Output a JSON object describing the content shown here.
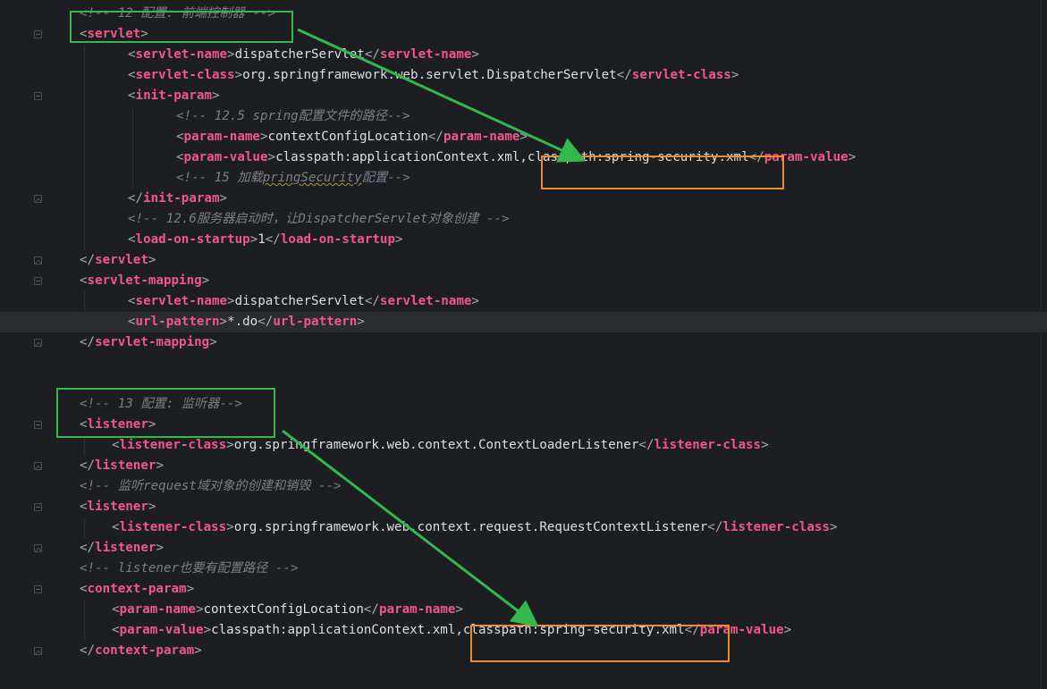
{
  "editor": {
    "lines": [
      {
        "parts": [
          {
            "t": "<!-- 12 配置: 前端控制器 -->",
            "c": "cm"
          }
        ]
      },
      {
        "parts": [
          {
            "t": "<",
            "c": "tb"
          },
          {
            "t": "servlet",
            "c": "tn"
          },
          {
            "t": ">",
            "c": "tb"
          }
        ]
      },
      {
        "parts": [
          {
            "t": "<",
            "c": "tb"
          },
          {
            "t": "servlet-name",
            "c": "tn"
          },
          {
            "t": ">",
            "c": "tb"
          },
          {
            "t": "dispatcherServlet",
            "c": "tx"
          },
          {
            "t": "</",
            "c": "tb"
          },
          {
            "t": "servlet-name",
            "c": "tn"
          },
          {
            "t": ">",
            "c": "tb"
          }
        ]
      },
      {
        "parts": [
          {
            "t": "<",
            "c": "tb"
          },
          {
            "t": "servlet-class",
            "c": "tn"
          },
          {
            "t": ">",
            "c": "tb"
          },
          {
            "t": "org.springframework.web.servlet.DispatcherServlet",
            "c": "tx"
          },
          {
            "t": "</",
            "c": "tb"
          },
          {
            "t": "servlet-class",
            "c": "tn"
          },
          {
            "t": ">",
            "c": "tb"
          }
        ]
      },
      {
        "parts": [
          {
            "t": "<",
            "c": "tb"
          },
          {
            "t": "init-param",
            "c": "tn"
          },
          {
            "t": ">",
            "c": "tb"
          }
        ]
      },
      {
        "parts": [
          {
            "t": "<!-- 12.5 spring配置文件的路径-->",
            "c": "cm"
          }
        ]
      },
      {
        "parts": [
          {
            "t": "<",
            "c": "tb"
          },
          {
            "t": "param-name",
            "c": "tn"
          },
          {
            "t": ">",
            "c": "tb"
          },
          {
            "t": "contextConfigLocation",
            "c": "tx"
          },
          {
            "t": "</",
            "c": "tb"
          },
          {
            "t": "param-name",
            "c": "tn"
          },
          {
            "t": ">",
            "c": "tb"
          }
        ]
      },
      {
        "parts": [
          {
            "t": "<",
            "c": "tb"
          },
          {
            "t": "param-value",
            "c": "tn"
          },
          {
            "t": ">",
            "c": "tb"
          },
          {
            "t": "classpath:applicationContext.xml,classpath:spring-security.xml",
            "c": "tx"
          },
          {
            "t": "</",
            "c": "tb"
          },
          {
            "t": "param-value",
            "c": "tn"
          },
          {
            "t": ">",
            "c": "tb"
          }
        ]
      },
      {
        "parts": [
          {
            "t": "<!-- 15 加载",
            "c": "cm"
          },
          {
            "t": "pringSecurity",
            "c": "cm sq"
          },
          {
            "t": "配置-->",
            "c": "cm"
          }
        ]
      },
      {
        "parts": [
          {
            "t": "</",
            "c": "tb"
          },
          {
            "t": "init-param",
            "c": "tn"
          },
          {
            "t": ">",
            "c": "tb"
          }
        ]
      },
      {
        "parts": [
          {
            "t": "<!-- 12.6服务器启动时，让DispatcherServlet对象创建 -->",
            "c": "cm"
          }
        ]
      },
      {
        "parts": [
          {
            "t": "<",
            "c": "tb"
          },
          {
            "t": "load-on-startup",
            "c": "tn"
          },
          {
            "t": ">",
            "c": "tb"
          },
          {
            "t": "1",
            "c": "tx"
          },
          {
            "t": "</",
            "c": "tb"
          },
          {
            "t": "load-on-startup",
            "c": "tn"
          },
          {
            "t": ">",
            "c": "tb"
          }
        ]
      },
      {
        "parts": [
          {
            "t": "</",
            "c": "tb"
          },
          {
            "t": "servlet",
            "c": "tn"
          },
          {
            "t": ">",
            "c": "tb"
          }
        ]
      },
      {
        "parts": [
          {
            "t": "<",
            "c": "tb"
          },
          {
            "t": "servlet-mapping",
            "c": "tn"
          },
          {
            "t": ">",
            "c": "tb"
          }
        ]
      },
      {
        "parts": [
          {
            "t": "<",
            "c": "tb"
          },
          {
            "t": "servlet-name",
            "c": "tn"
          },
          {
            "t": ">",
            "c": "tb"
          },
          {
            "t": "dispatcherServlet",
            "c": "tx"
          },
          {
            "t": "</",
            "c": "tb"
          },
          {
            "t": "servlet-name",
            "c": "tn"
          },
          {
            "t": ">",
            "c": "tb"
          }
        ]
      },
      {
        "parts": [
          {
            "t": "<",
            "c": "tb"
          },
          {
            "t": "url-pattern",
            "c": "tn"
          },
          {
            "t": ">",
            "c": "tb"
          },
          {
            "t": "*.do",
            "c": "tx"
          },
          {
            "t": "</",
            "c": "tb"
          },
          {
            "t": "url-pattern",
            "c": "tn"
          },
          {
            "t": ">",
            "c": "tb"
          }
        ]
      },
      {
        "parts": [
          {
            "t": "</",
            "c": "tb"
          },
          {
            "t": "servlet-mapping",
            "c": "tn"
          },
          {
            "t": ">",
            "c": "tb"
          }
        ]
      },
      {
        "parts": []
      },
      {
        "parts": []
      },
      {
        "parts": [
          {
            "t": "<!-- 13 配置: 监听器-->",
            "c": "cm"
          }
        ]
      },
      {
        "parts": [
          {
            "t": "<",
            "c": "tb"
          },
          {
            "t": "listener",
            "c": "tn"
          },
          {
            "t": ">",
            "c": "tb"
          }
        ]
      },
      {
        "parts": [
          {
            "t": "<",
            "c": "tb"
          },
          {
            "t": "listener-class",
            "c": "tn"
          },
          {
            "t": ">",
            "c": "tb"
          },
          {
            "t": "org.springframework.web.context.ContextLoaderListener",
            "c": "tx"
          },
          {
            "t": "</",
            "c": "tb"
          },
          {
            "t": "listener-class",
            "c": "tn"
          },
          {
            "t": ">",
            "c": "tb"
          }
        ]
      },
      {
        "parts": [
          {
            "t": "</",
            "c": "tb"
          },
          {
            "t": "listener",
            "c": "tn"
          },
          {
            "t": ">",
            "c": "tb"
          }
        ]
      },
      {
        "parts": [
          {
            "t": "<!-- 监听request域对象的创建和销毁 -->",
            "c": "cm"
          }
        ]
      },
      {
        "parts": [
          {
            "t": "<",
            "c": "tb"
          },
          {
            "t": "listener",
            "c": "tn"
          },
          {
            "t": ">",
            "c": "tb"
          }
        ]
      },
      {
        "parts": [
          {
            "t": "<",
            "c": "tb"
          },
          {
            "t": "listener-class",
            "c": "tn"
          },
          {
            "t": ">",
            "c": "tb"
          },
          {
            "t": "org.springframework.web.context.request.RequestContextListener",
            "c": "tx"
          },
          {
            "t": "</",
            "c": "tb"
          },
          {
            "t": "listener-class",
            "c": "tn"
          },
          {
            "t": ">",
            "c": "tb"
          }
        ]
      },
      {
        "parts": [
          {
            "t": "</",
            "c": "tb"
          },
          {
            "t": "listener",
            "c": "tn"
          },
          {
            "t": ">",
            "c": "tb"
          }
        ]
      },
      {
        "parts": [
          {
            "t": "<!-- listener也要有配置路径 -->",
            "c": "cm"
          }
        ]
      },
      {
        "parts": [
          {
            "t": "<",
            "c": "tb"
          },
          {
            "t": "context-param",
            "c": "tn"
          },
          {
            "t": ">",
            "c": "tb"
          }
        ]
      },
      {
        "parts": [
          {
            "t": "<",
            "c": "tb"
          },
          {
            "t": "param-name",
            "c": "tn"
          },
          {
            "t": ">",
            "c": "tb"
          },
          {
            "t": "contextConfigLocation",
            "c": "tx"
          },
          {
            "t": "</",
            "c": "tb"
          },
          {
            "t": "param-name",
            "c": "tn"
          },
          {
            "t": ">",
            "c": "tb"
          }
        ]
      },
      {
        "parts": [
          {
            "t": "<",
            "c": "tb"
          },
          {
            "t": "param-value",
            "c": "tn"
          },
          {
            "t": ">",
            "c": "tb"
          },
          {
            "t": "classpath:applicationContext.xml,classpath:spring-security.xml",
            "c": "tx"
          },
          {
            "t": "</",
            "c": "tb"
          },
          {
            "t": "param-value",
            "c": "tn"
          },
          {
            "t": ">",
            "c": "tb"
          }
        ]
      },
      {
        "parts": [
          {
            "t": "</",
            "c": "tb"
          },
          {
            "t": "context-param",
            "c": "tn"
          },
          {
            "t": ">",
            "c": "tb"
          }
        ]
      }
    ],
    "highlighted_line": 15
  },
  "colors": {
    "background": "#1c1e22",
    "tag_name": "#f0578b",
    "comment": "#7b7f86",
    "annotation_green": "#34b84c",
    "annotation_orange": "#f28a2f"
  }
}
